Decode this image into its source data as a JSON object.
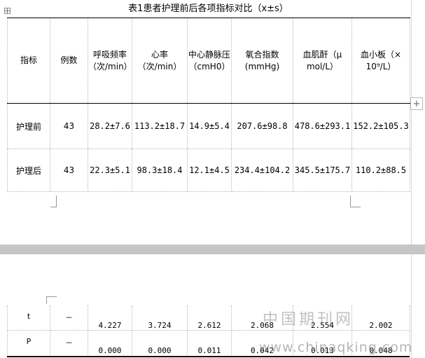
{
  "caption": "表1患者护理前后各项指标对比（x±s）",
  "header": [
    [
      "指标"
    ],
    [
      "例数"
    ],
    [
      "呼吸频率",
      "（次/min）"
    ],
    [
      "心率（次/min）"
    ],
    [
      "中心静脉压",
      "（cmH0）"
    ],
    [
      "氧合指数(mmHg)"
    ],
    [
      "血肌酐（μ",
      "mol/L）"
    ],
    [
      "血小板（×",
      "10⁹/L）"
    ]
  ],
  "rows": [
    {
      "label": "护理前",
      "n": "43",
      "v": [
        "28.2±7.6",
        "113.2±18.7",
        "14.9±5.4",
        "207.6±98.8",
        "478.6±293.1",
        "152.2±105.3"
      ]
    },
    {
      "label": "护理后",
      "n": "43",
      "v": [
        "22.3±5.1",
        "98.3±18.4",
        "12.1±4.5",
        "234.4±104.2",
        "345.5±175.7",
        "110.2±88.5"
      ]
    }
  ],
  "stats": [
    {
      "label": "t",
      "n": "－",
      "v": [
        "4.227",
        "3.724",
        "2.612",
        "2.068",
        "2.554",
        "2.002"
      ]
    },
    {
      "label": "P",
      "n": "－",
      "v": [
        "0.000",
        "0.000",
        "0.011",
        "0.042",
        "0.013",
        "0.048"
      ]
    }
  ],
  "watermark": {
    "cn": "中国期刊网",
    "url": "www.chinaqking.com"
  },
  "ui": {
    "expand_symbol": "+"
  }
}
